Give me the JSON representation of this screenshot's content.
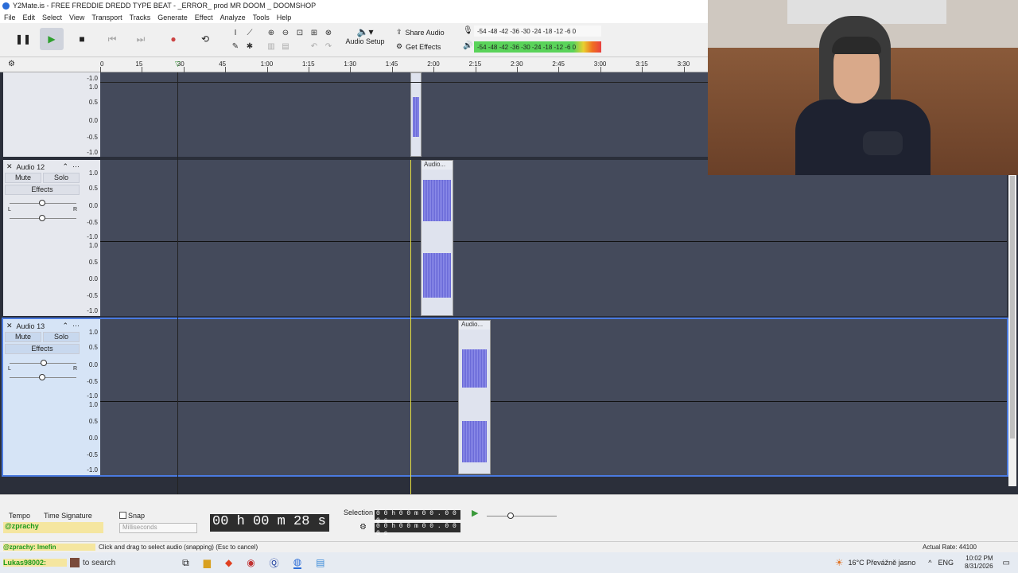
{
  "window": {
    "title": "Y2Mate.is - FREE FREDDIE DREDD TYPE BEAT - _ERROR_ prod MR DOOM _ DOOMSHOP"
  },
  "menu": [
    "File",
    "Edit",
    "Select",
    "View",
    "Transport",
    "Tracks",
    "Generate",
    "Effect",
    "Analyze",
    "Tools",
    "Help"
  ],
  "toolbar": {
    "audio_setup": "Audio Setup",
    "share_audio": "Share Audio",
    "get_effects": "Get Effects",
    "record_meter": {
      "channels": "L\nR",
      "scale": [
        "-54",
        "-48",
        "-42",
        "-36",
        "-30",
        "-24",
        "-18",
        "-12",
        "-6",
        "0"
      ]
    },
    "play_meter": {
      "scale": [
        "-54",
        "-48",
        "-42",
        "-36",
        "-30",
        "-24",
        "-18",
        "-12",
        "-6",
        "0"
      ]
    }
  },
  "ruler": {
    "ticks": [
      "0",
      "15",
      "30",
      "45",
      "1:00",
      "1:15",
      "1:30",
      "1:45",
      "2:00",
      "2:15",
      "2:30",
      "2:45",
      "3:00",
      "3:15",
      "3:30"
    ]
  },
  "scale_labels": [
    "1.0",
    "0.5",
    "0.0",
    "-0.5",
    "-1.0"
  ],
  "tracks": [
    {
      "name": "Audio 12",
      "mute": "Mute",
      "solo": "Solo",
      "effects": "Effects",
      "pan_left": "L",
      "pan_right": "R",
      "clip_label": "Audio..."
    },
    {
      "name": "Audio 13",
      "mute": "Mute",
      "solo": "Solo",
      "effects": "Effects",
      "pan_left": "L",
      "pan_right": "R",
      "clip_label": "Audio..."
    }
  ],
  "bottom": {
    "tempo": "Tempo",
    "time_signature": "Time Signature",
    "snap": "Snap",
    "snap_unit": "Milliseconds",
    "time_display": "00 h 00 m 28 s",
    "selection": "Selection",
    "sel_start": "0 0 h 0 0 m 0 0 . 0 0 0 s",
    "sel_end": "0 0 h 0 0 m 0 0 . 0 0 0 s"
  },
  "status": {
    "message": "Click and drag to select audio (snapping) (Esc to cancel)",
    "rate": "Actual Rate: 44100",
    "overlay_text": "@zprachy: Imefin"
  },
  "taskbar": {
    "search": "to search",
    "search_overlay": "Lukas98002:",
    "weather": "16°C  Převážně jasno",
    "lang": "ENG",
    "time": "10:02 PM",
    "date": "8/31/2026"
  },
  "overlay": {
    "badge": "@zprachy"
  },
  "colors": {
    "waveform": "#6a6ad8",
    "playhead": "#e8e040",
    "selected_track": "#4a7ae0"
  }
}
